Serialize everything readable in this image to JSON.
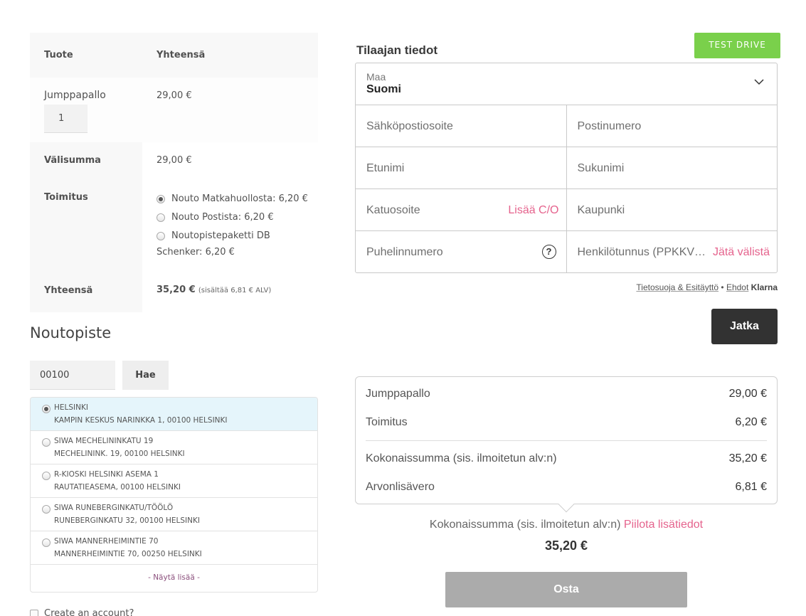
{
  "order": {
    "header": {
      "product": "Tuote",
      "total": "Yhteensä"
    },
    "item": {
      "name": "Jumppapallo",
      "qty": "1",
      "price": "29,00 €"
    },
    "subtotal": {
      "label": "Välisumma",
      "value": "29,00 €"
    },
    "shipping": {
      "label": "Toimitus",
      "options": [
        {
          "text": "Nouto Matkahuollosta: 6,20 €",
          "selected": true
        },
        {
          "text": "Nouto Postista: 6,20 €",
          "selected": false
        },
        {
          "text": "Noutopistepaketti DB",
          "cont": "Schenker: 6,20 €",
          "selected": false
        }
      ]
    },
    "total": {
      "label": "Yhteensä",
      "value": "35,20 €",
      "vat_note": "(sisältää 6,81 € ALV)"
    }
  },
  "pickup": {
    "title": "Noutopiste",
    "postcode": "00100",
    "search_label": "Hae",
    "points": [
      {
        "name": "HELSINKI",
        "address": "KAMPIN KESKUS NARINKKA 1, 00100 HELSINKI",
        "selected": true
      },
      {
        "name": "SIWA MECHELININKATU 19",
        "address": "MECHELININK. 19, 00100 HELSINKI",
        "selected": false
      },
      {
        "name": "R-KIOSKI HELSINKI ASEMA 1",
        "address": "RAUTATIEASEMA, 00100 HELSINKI",
        "selected": false
      },
      {
        "name": "SIWA RUNEBERGINKATU/TÖÖLÖ",
        "address": "RUNEBERGINKATU 32, 00100 HELSINKI",
        "selected": false
      },
      {
        "name": "SIWA MANNERHEIMINTIE 70",
        "address": "MANNERHEIMINTIE 70, 00250 HELSINKI",
        "selected": false
      }
    ],
    "show_more": "- Näytä lisää -",
    "create_account": "Create an account?"
  },
  "klarna": {
    "test_drive": "TEST DRIVE",
    "title": "Tilaajan tiedot",
    "country_label": "Maa",
    "country_value": "Suomi",
    "fields": {
      "email": "Sähköpostiosoite",
      "postcode": "Postinumero",
      "first_name": "Etunimi",
      "last_name": "Sukunimi",
      "street": "Katuosoite",
      "add_co": "Lisää C/O",
      "city": "Kaupunki",
      "phone": "Puhelinnumero",
      "ssn": "Henkilötunnus (PPKKVVSSSS)",
      "skip": "Jätä välistä"
    },
    "terms": {
      "privacy": "Tietosuoja & Esitäyttö",
      "sep": "•",
      "terms": "Ehdot",
      "brand": "Klarna"
    },
    "continue": "Jatka",
    "summary": {
      "lines": [
        {
          "label": "Jumppapallo",
          "amount": "29,00 €"
        },
        {
          "label": "Toimitus",
          "amount": "6,20 €"
        },
        {
          "label": "Kokonaissumma (sis. ilmoitetun alv:n)",
          "amount": "35,20 €"
        },
        {
          "label": "Arvonlisävero",
          "amount": "6,81 €"
        }
      ]
    },
    "total_label": "Kokonaissumma (sis. ilmoitetun alv:n)",
    "hide_details": "Piilota lisätiedot",
    "total_value": "35,20 €",
    "buy": "Osta"
  },
  "colors": {
    "accent_pink": "#e5638d",
    "test_drive_green": "#7ad04b",
    "button_dark": "#323232"
  }
}
